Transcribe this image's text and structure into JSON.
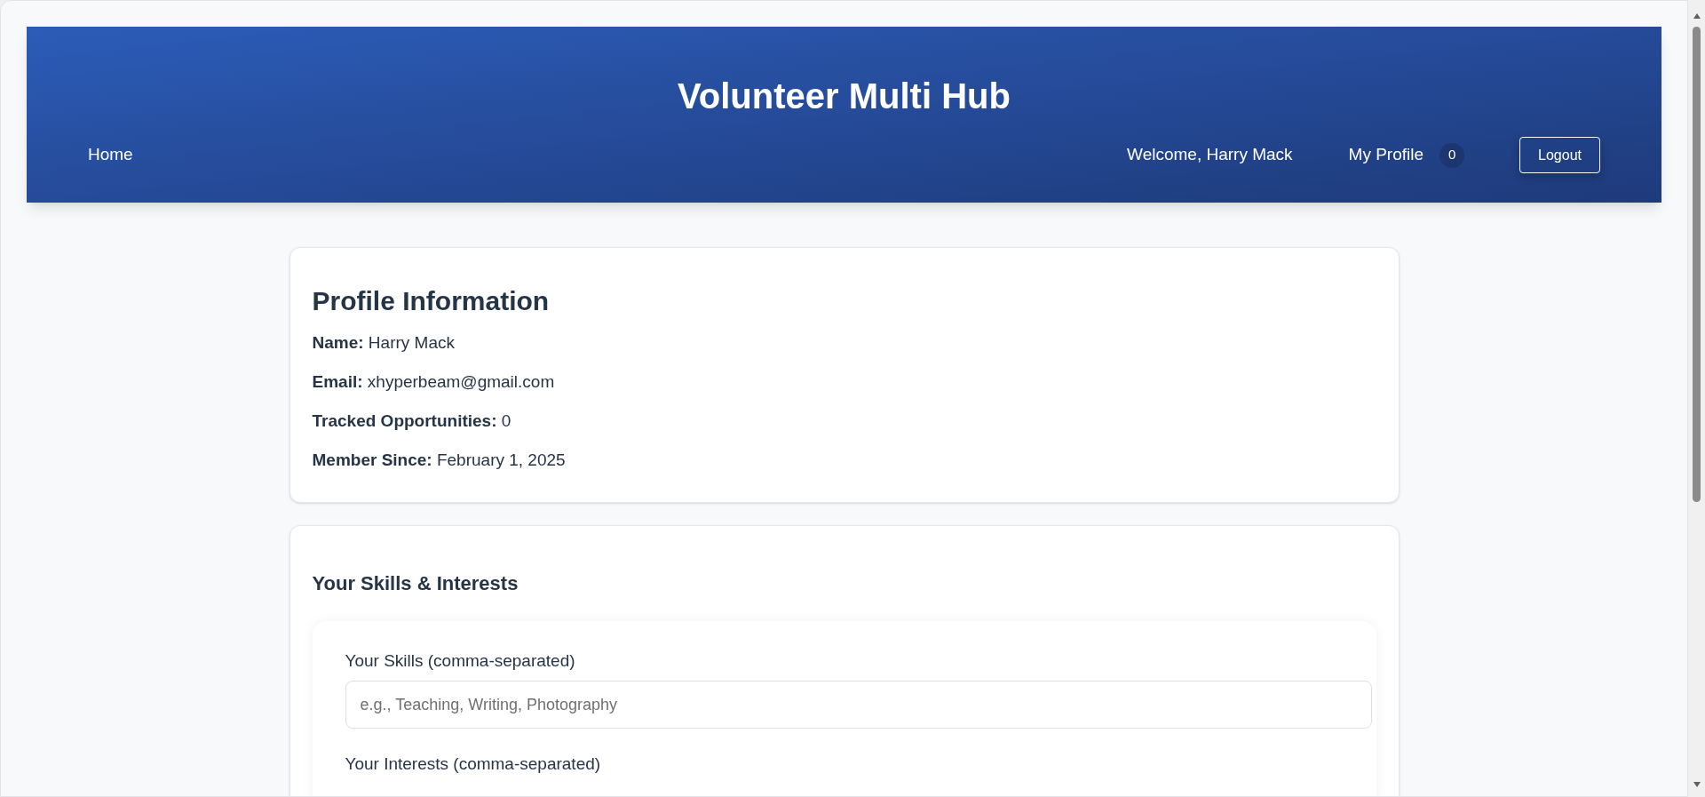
{
  "header": {
    "title": "Volunteer Multi Hub",
    "nav_left": [
      {
        "label": "Home"
      }
    ],
    "welcome": "Welcome, Harry Mack",
    "profile_link": {
      "label": "My Profile",
      "badge": "0"
    },
    "logout_button": "Logout"
  },
  "profile_card": {
    "heading": "Profile Information",
    "fields": [
      {
        "label": "Name:",
        "value": "Harry Mack"
      },
      {
        "label": "Email:",
        "value": "xhyperbeam@gmail.com"
      },
      {
        "label": "Tracked Opportunities:",
        "value": "0"
      },
      {
        "label": "Member Since:",
        "value": "February 1, 2025"
      }
    ]
  },
  "skills_card": {
    "heading": "Your Skills & Interests",
    "fields": [
      {
        "label": "Your Skills (comma-separated)",
        "placeholder": "e.g., Teaching, Writing, Photography"
      },
      {
        "label": "Your Interests (comma-separated)"
      }
    ]
  }
}
